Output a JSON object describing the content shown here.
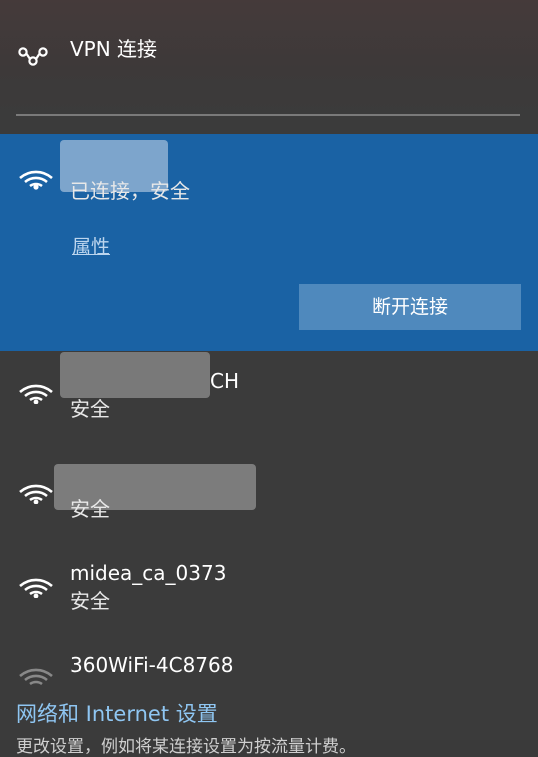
{
  "vpn": {
    "label": "VPN 连接"
  },
  "networks": [
    {
      "ssid": "",
      "status": "已连接，安全",
      "properties_link": "属性",
      "disconnect_label": "断开连接"
    },
    {
      "ssid": "CH",
      "status": "安全"
    },
    {
      "ssid": "",
      "status": "安全"
    },
    {
      "ssid": "midea_ca_0373",
      "status": "安全"
    },
    {
      "ssid": "360WiFi-4C8768",
      "status": ""
    }
  ],
  "footer": {
    "settings_link": "网络和 Internet 设置",
    "settings_sub": "更改设置，例如将某连接设置为按流量计费。"
  },
  "colors": {
    "active_bg": "#1a62a4",
    "panel_bg": "#3b3b3b",
    "link": "#8fc6f2",
    "button": "#4f89bd"
  }
}
